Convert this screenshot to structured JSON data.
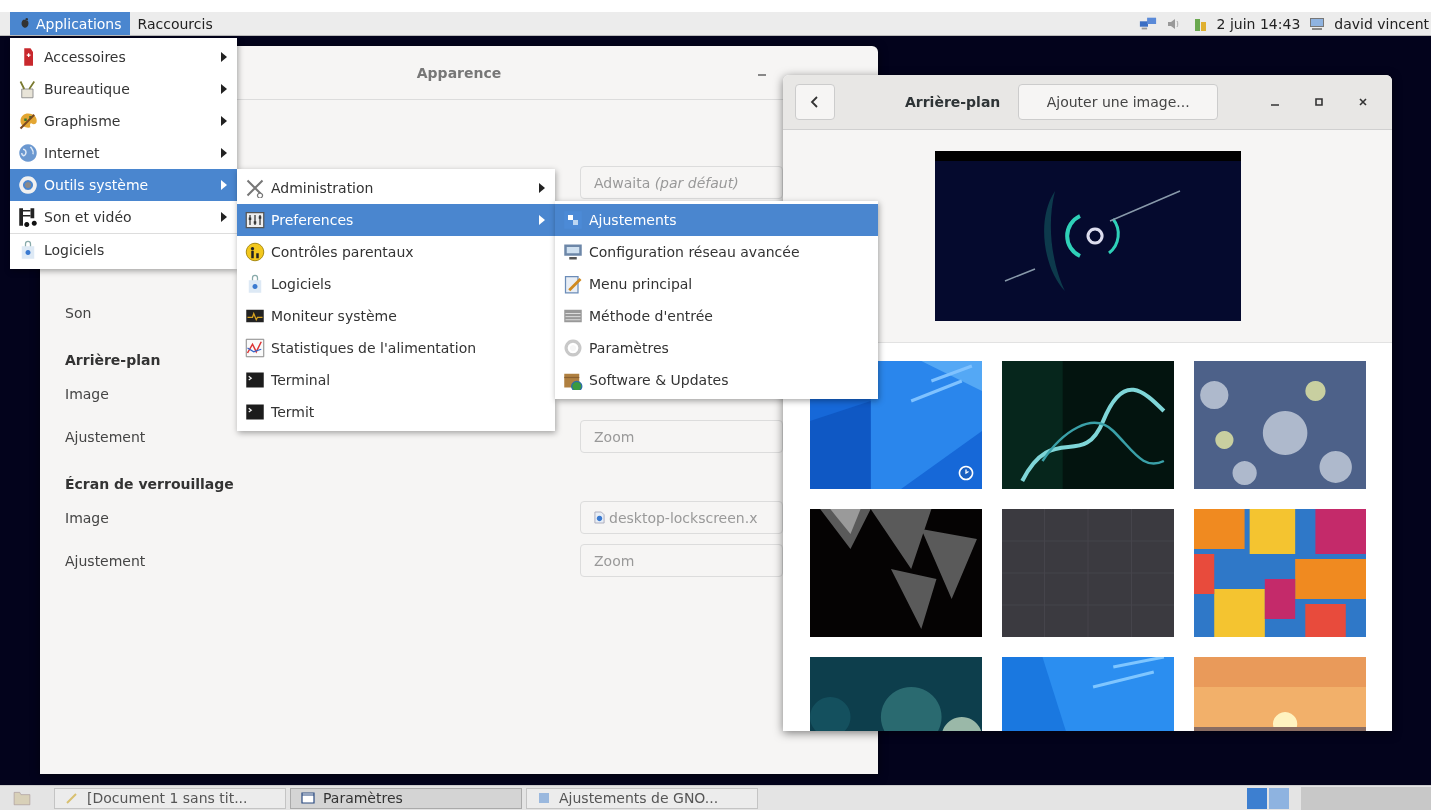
{
  "top_panel": {
    "menus": [
      {
        "label": "Applications",
        "selected": true
      },
      {
        "label": "Raccourcis",
        "selected": false
      }
    ],
    "clock": "2 juin 14:43",
    "user": "david vincent"
  },
  "appearance_window": {
    "title": "Apparence",
    "rows": [
      {
        "kind": "field",
        "label": "",
        "value": "Adwaita *(par défaut)*"
      },
      {
        "kind": "label",
        "label": "Son"
      },
      {
        "kind": "heading",
        "label": "Arrière-plan"
      },
      {
        "kind": "label",
        "label": "Image"
      },
      {
        "kind": "field",
        "label": "Ajustement",
        "value": "Zoom"
      },
      {
        "kind": "heading",
        "label": "Écran de verrouillage"
      },
      {
        "kind": "file",
        "label": "Image",
        "value": "desktop-lockscreen.x"
      },
      {
        "kind": "field",
        "label": "Ajustement",
        "value": "Zoom"
      }
    ]
  },
  "background_window": {
    "title": "Arrière-plan",
    "add_button": "Ajouter une image...",
    "thumbnails": [
      {
        "kind": "picture",
        "selected": true
      },
      {
        "kind": "picture",
        "selected": false
      },
      {
        "kind": "picture",
        "selected": false
      },
      {
        "kind": "picture",
        "selected": false
      },
      {
        "kind": "picture",
        "selected": false
      },
      {
        "kind": "picture",
        "selected": false
      },
      {
        "kind": "picture",
        "selected": false
      },
      {
        "kind": "picture",
        "selected": false
      },
      {
        "kind": "picture",
        "selected": false
      }
    ]
  },
  "app_menu": {
    "items": [
      {
        "label": "Accessoires",
        "submenu": true,
        "selected": false,
        "separator_above": false
      },
      {
        "label": "Bureautique",
        "submenu": true,
        "selected": false,
        "separator_above": false
      },
      {
        "label": "Graphisme",
        "submenu": true,
        "selected": false,
        "separator_above": false
      },
      {
        "label": "Internet",
        "submenu": true,
        "selected": false,
        "separator_above": false
      },
      {
        "label": "Outils système",
        "submenu": true,
        "selected": true,
        "separator_above": false
      },
      {
        "label": "Son et vidéo",
        "submenu": true,
        "selected": false,
        "separator_above": false
      },
      {
        "label": "Logiciels",
        "submenu": false,
        "selected": false,
        "separator_above": true
      }
    ]
  },
  "system_tools_menu": {
    "items": [
      {
        "label": "Administration",
        "submenu": true,
        "selected": false
      },
      {
        "label": "Preferences",
        "submenu": true,
        "selected": true
      },
      {
        "label": "Contrôles parentaux",
        "submenu": false,
        "selected": false
      },
      {
        "label": "Logiciels",
        "submenu": false,
        "selected": false
      },
      {
        "label": "Moniteur système",
        "submenu": false,
        "selected": false
      },
      {
        "label": "Statistiques de l'alimentation",
        "submenu": false,
        "selected": false
      },
      {
        "label": "Terminal",
        "submenu": false,
        "selected": false
      },
      {
        "label": "Termit",
        "submenu": false,
        "selected": false
      }
    ]
  },
  "preferences_menu": {
    "items": [
      {
        "label": "Ajustements",
        "submenu": false,
        "selected": true
      },
      {
        "label": "Configuration réseau avancée",
        "submenu": false,
        "selected": false
      },
      {
        "label": "Menu principal",
        "submenu": false,
        "selected": false
      },
      {
        "label": "Méthode d'entrée",
        "submenu": false,
        "selected": false
      },
      {
        "label": "Paramètres",
        "submenu": false,
        "selected": false
      },
      {
        "label": "Software & Updates",
        "submenu": false,
        "selected": false
      }
    ]
  },
  "taskbar": {
    "tasks": [
      {
        "label": "[Document 1 sans tit...",
        "selected": false
      },
      {
        "label": "Paramètres",
        "selected": true
      },
      {
        "label": "Ajustements de GNO...",
        "selected": false
      }
    ]
  }
}
